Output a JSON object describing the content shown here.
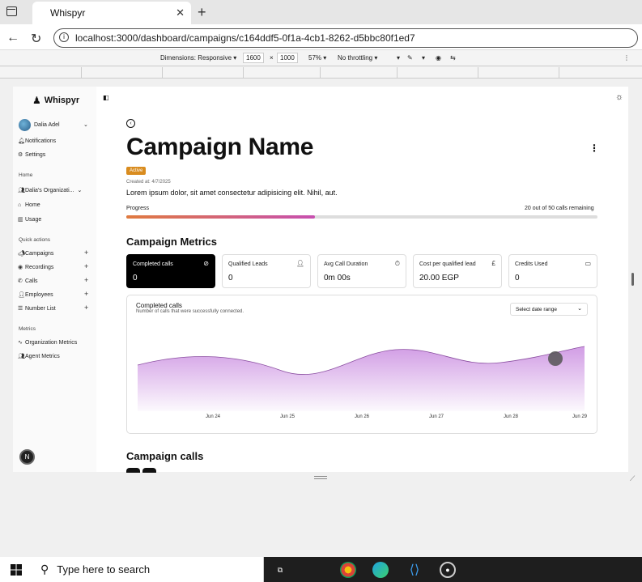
{
  "browser": {
    "tab_title": "Whispyr",
    "url": "localhost:3000/dashboard/campaigns/c164ddf5-0f1a-4cb1-8262-d5bbc80f1ed7"
  },
  "devtools": {
    "dimensions_label": "Dimensions: Responsive",
    "width": "1600",
    "times": "×",
    "height": "1000",
    "zoom": "57%",
    "throttle": "No throttling"
  },
  "sidebar": {
    "brand": "Whispyr",
    "user": "Dalia Adel",
    "top_items": [
      "Notifications",
      "Settings"
    ],
    "home_header": "Home",
    "home_items": [
      "Dalia's Organizati...",
      "Home",
      "Usage"
    ],
    "quick_header": "Quick actions",
    "quick_items": [
      "Campaigns",
      "Recordings",
      "Calls",
      "Employees",
      "Number List"
    ],
    "metrics_header": "Metrics",
    "metrics_items": [
      "Organization Metrics",
      "Agent Metrics"
    ],
    "badge": "N"
  },
  "campaign": {
    "title": "Campaign Name",
    "status": "Active",
    "created": "Created at: 4/7/2025",
    "description": "Lorem ipsum dolor, sit amet consectetur adipisicing elit. Nihil, aut.",
    "progress_label": "Progress",
    "progress_text": "20 out of 50 calls remaining",
    "progress_fraction": 0.4
  },
  "metrics": {
    "title": "Campaign Metrics",
    "cards": [
      {
        "label": "Completed calls",
        "value": "0",
        "icon": "check-circle-icon"
      },
      {
        "label": "Qualified Leads",
        "value": "0",
        "icon": "user-check-icon"
      },
      {
        "label": "Avg Call Duration",
        "value": "0m 00s",
        "icon": "timer-icon"
      },
      {
        "label": "Cost per qualified lead",
        "value": "20.00 EGP",
        "icon": "pound-icon"
      },
      {
        "label": "Credits Used",
        "value": "0",
        "icon": "card-icon"
      }
    ]
  },
  "chart": {
    "title": "Completed calls",
    "subtitle": "Number of calls that were successfully connected.",
    "date_range_label": "Select date range"
  },
  "chart_data": {
    "type": "area",
    "categories": [
      "Jun 24",
      "Jun 25",
      "Jun 26",
      "Jun 27",
      "Jun 28",
      "Jun 29"
    ],
    "values": [
      null,
      null,
      null,
      null,
      null,
      null
    ],
    "fill_color": "#c98be0",
    "xlabel": "",
    "ylabel": "",
    "grid": false
  },
  "calls": {
    "title": "Campaign calls"
  },
  "taskbar": {
    "search_placeholder": "Type here to search"
  }
}
